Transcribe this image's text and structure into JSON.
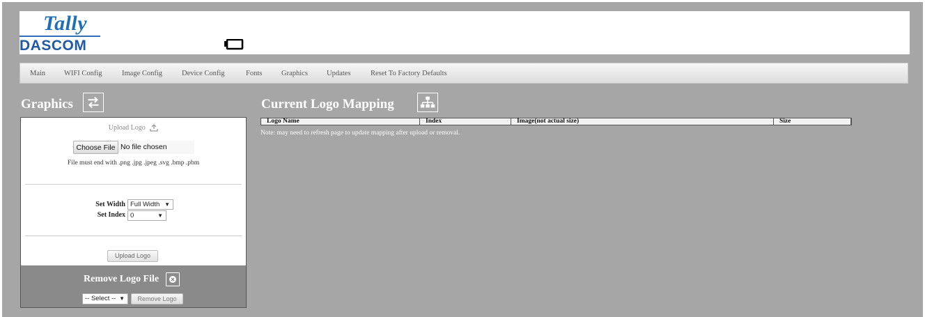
{
  "brand": {
    "line1": "Tally",
    "line2": "DASCOM"
  },
  "header": {
    "status_icon": "battery-icon"
  },
  "nav": {
    "items": [
      {
        "label": "Main"
      },
      {
        "label": "WIFI Config"
      },
      {
        "label": "Image Config"
      },
      {
        "label": "Device Config"
      },
      {
        "label": "Fonts"
      },
      {
        "label": "Graphics"
      },
      {
        "label": "Updates"
      },
      {
        "label": "Reset To Factory Defaults"
      }
    ]
  },
  "graphics": {
    "title": "Graphics",
    "title_icon": "swap-arrows-icon",
    "upload": {
      "heading": "Upload Logo",
      "heading_icon": "upload-icon",
      "choose_file_label": "Choose File",
      "no_file_text": "No file chosen",
      "file_note": "File must end with .png .jpg .jpeg .svg .bmp .pbm",
      "set_width_label": "Set Width",
      "set_width_value": "Full Width",
      "set_index_label": "Set Index",
      "set_index_value": "0",
      "upload_button": "Upload Logo"
    },
    "remove": {
      "title": "Remove Logo File",
      "title_icon": "remove-circle-icon",
      "select_value": "-- Select --",
      "remove_button": "Remove Logo"
    }
  },
  "mapping": {
    "title": "Current Logo Mapping",
    "title_icon": "sitemap-icon",
    "columns": [
      "Logo Name",
      "Index",
      "Image(not actual size)",
      "Size"
    ],
    "note": "Note: may need to refresh page to update mapping after upload or removal."
  },
  "colors": {
    "background": "#a6a6a6",
    "brand_blue": "#1f6fb8",
    "panel": "#ffffff",
    "remove_area": "#8a8a8a"
  }
}
